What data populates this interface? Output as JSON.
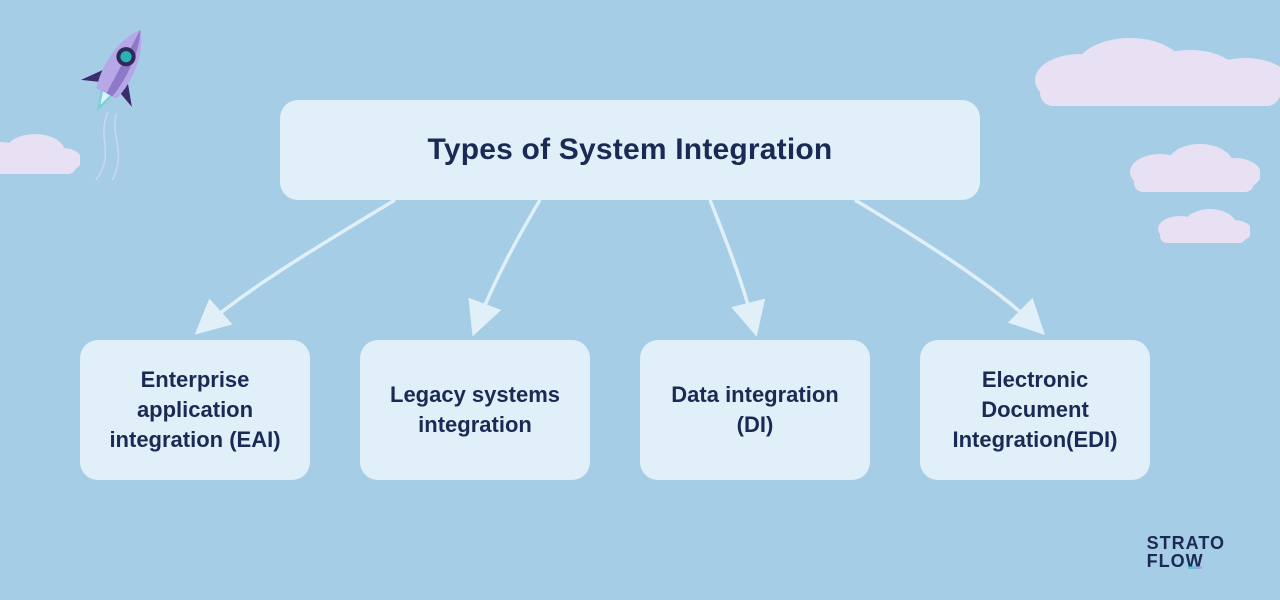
{
  "title": "Types of System Integration",
  "children": [
    "Enterprise application integration (EAI)",
    "Legacy systems integration",
    "Data integration (DI)",
    "Electronic Document Integration(EDI)"
  ],
  "logo": {
    "line1": "STRATO",
    "line2": "FLOW"
  },
  "colors": {
    "background": "#a5cde6",
    "box": "#e1eff8",
    "text": "#1b2a55",
    "cloud": "#e8e0f3",
    "arrow": "#e1eff8"
  }
}
